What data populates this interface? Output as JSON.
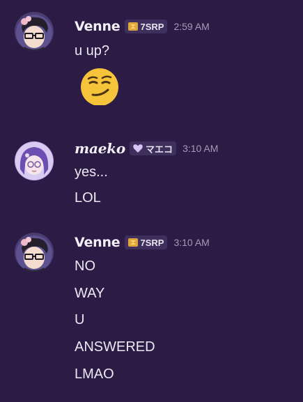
{
  "colors": {
    "background": "#2c1c45",
    "text": "#ece8f4",
    "timestamp": "#a59bb8",
    "tag_background": "#3f2f5c"
  },
  "messages": [
    {
      "author": "Venne",
      "tag": "7SRP",
      "tag_icon": "gold-tag-icon",
      "timestamp": "2:59 AM",
      "lines": [
        "u up?"
      ],
      "emoji": "smirking-face-emoji"
    },
    {
      "author": "maeko",
      "tag": "マエコ",
      "tag_icon": "heart-icon",
      "timestamp": "3:10 AM",
      "lines": [
        "yes...",
        "LOL"
      ]
    },
    {
      "author": "Venne",
      "tag": "7SRP",
      "tag_icon": "gold-tag-icon",
      "timestamp": "3:10 AM",
      "lines": [
        "NO",
        "WAY",
        "U",
        "ANSWERED",
        "LMAO"
      ]
    }
  ]
}
